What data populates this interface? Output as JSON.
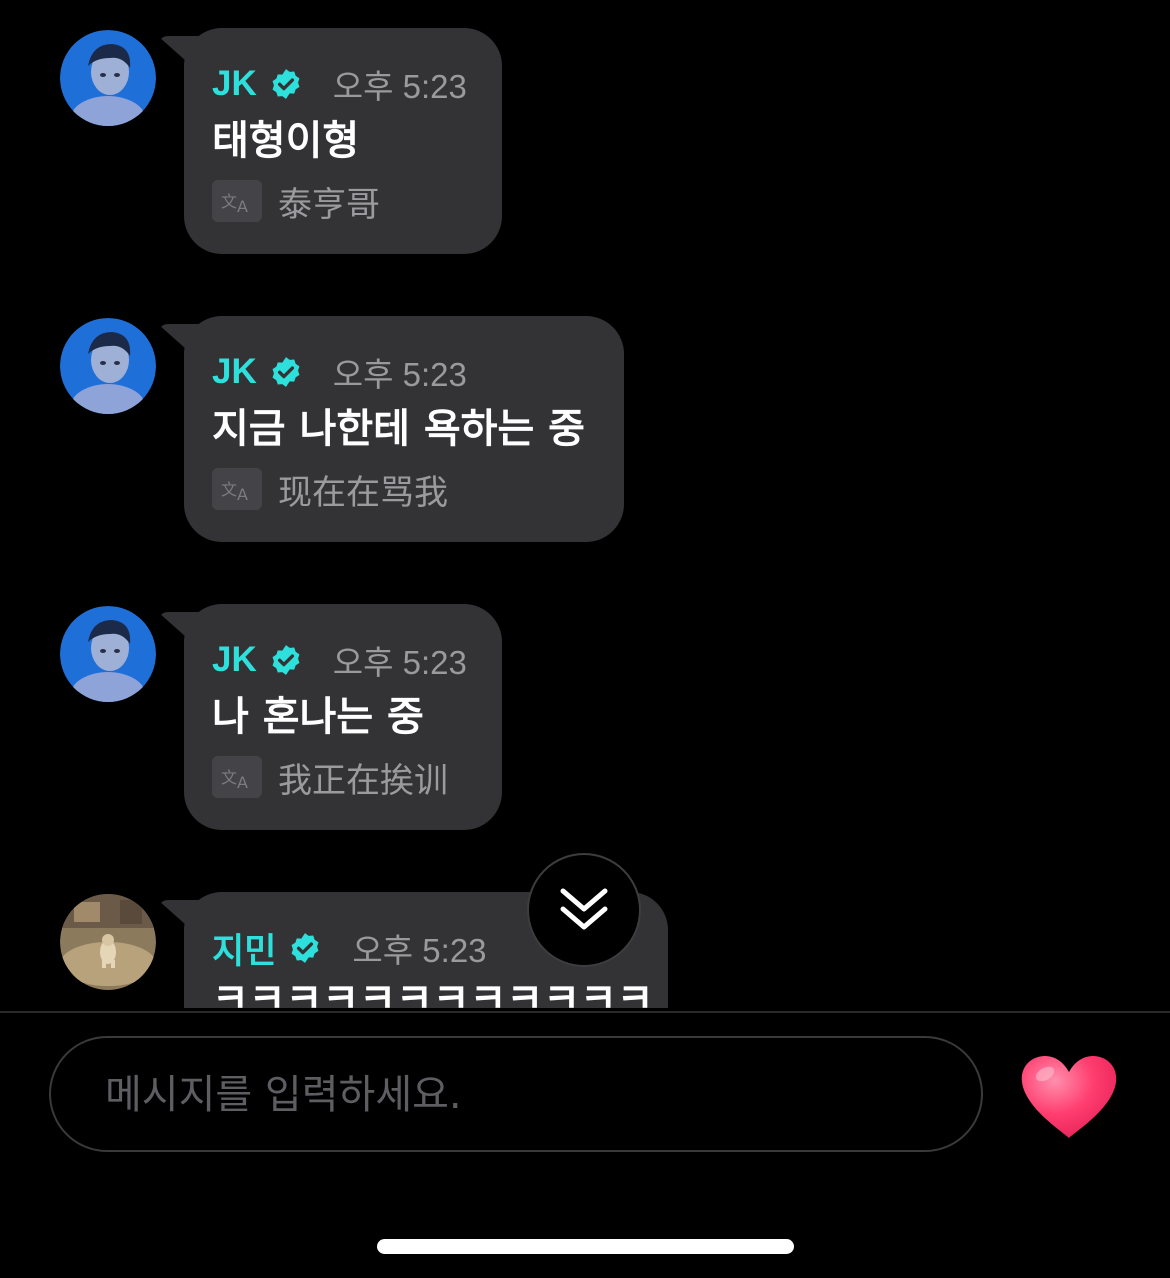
{
  "messages": [
    {
      "sender": "JK",
      "time": "오후 5:23",
      "text": "태형이형",
      "translation": "泰亨哥",
      "avatar_icon": "portrait-avatar-blue"
    },
    {
      "sender": "JK",
      "time": "오후 5:23",
      "text": "지금 나한테 욕하는 중",
      "translation": "现在在骂我",
      "avatar_icon": "portrait-avatar-blue"
    },
    {
      "sender": "JK",
      "time": "오후 5:23",
      "text": "나 혼나는 중",
      "translation": "我正在挨训",
      "avatar_icon": "portrait-avatar-blue"
    },
    {
      "sender": "지민",
      "time": "오후 5:23",
      "text": "ㅋㅋㅋㅋㅋㅋㅋㅋㅋㅋㅋㅋ",
      "avatar_icon": "dog-photo-avatar"
    }
  ],
  "composer": {
    "placeholder": "메시지를 입력하세요.",
    "send_icon": "heart-icon"
  },
  "colors": {
    "background": "#000000",
    "bubble": "#333336",
    "sender": "#2ee0dc",
    "verified": "#2ee0dc",
    "heart": "#ff3d6e"
  }
}
